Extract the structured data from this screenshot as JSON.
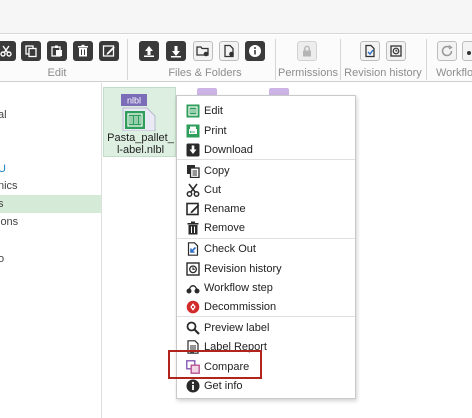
{
  "ribbon": {
    "groups": {
      "edit": "Edit",
      "files_folders": "Files & Folders",
      "permissions": "Permissions",
      "revision_history": "Revision history",
      "workflow": "Workflo"
    }
  },
  "sidebar": {
    "items": [
      "al",
      "l",
      "U",
      "nics",
      "s",
      "ions",
      "o"
    ]
  },
  "file": {
    "name": "Pasta_pallet_l-abel.nlbl",
    "badge": "nlbl"
  },
  "context_menu": {
    "items": [
      {
        "label": "Edit",
        "icon": "edit-icon"
      },
      {
        "label": "Print",
        "icon": "print-icon"
      },
      {
        "label": "Download",
        "icon": "download-icon"
      },
      {
        "label": "Copy",
        "icon": "copy-icon"
      },
      {
        "label": "Cut",
        "icon": "cut-icon"
      },
      {
        "label": "Rename",
        "icon": "rename-icon"
      },
      {
        "label": "Remove",
        "icon": "trash-icon"
      },
      {
        "label": "Check Out",
        "icon": "check-out-icon"
      },
      {
        "label": "Revision history",
        "icon": "revision-history-icon"
      },
      {
        "label": "Workflow step",
        "icon": "workflow-icon"
      },
      {
        "label": "Decommission",
        "icon": "decommission-icon"
      },
      {
        "label": "Preview label",
        "icon": "magnifier-icon"
      },
      {
        "label": "Label Report",
        "icon": "report-icon"
      },
      {
        "label": "Compare",
        "icon": "compare-icon"
      },
      {
        "label": "Get info",
        "icon": "info-icon"
      }
    ]
  },
  "colors": {
    "accent_green": "#2e9e5b",
    "highlight_red": "#b0241c",
    "selection_green": "#d6ead8"
  }
}
